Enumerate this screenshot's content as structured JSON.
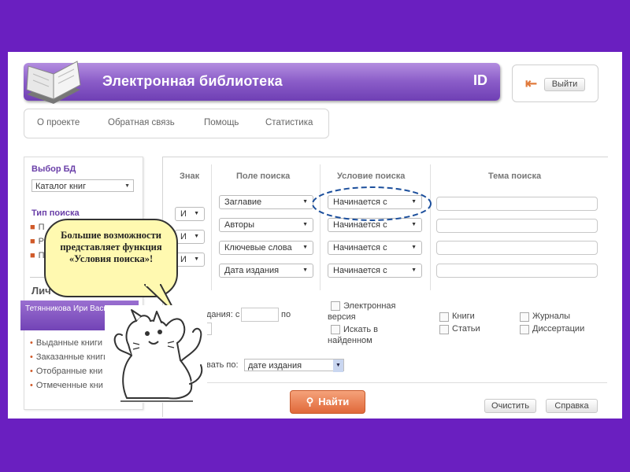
{
  "header": {
    "title": "Электронная библиотека",
    "logo_text": "ID",
    "exit_label": "Выйти"
  },
  "nav": {
    "items": [
      "О проекте",
      "Обратная связь",
      "Помощь",
      "Статистика"
    ]
  },
  "left_panel": {
    "db_title": "Выбор БД",
    "db_value": "Каталог книг",
    "search_type_title": "Тип поиска",
    "search_type_items": [
      "П",
      "Р",
      "П"
    ],
    "cabinet_title": "Лич",
    "user_name": "Тетянникова Ири Васильевна",
    "menu": [
      "Выданные книги",
      "Заказанные книги",
      "Отобранные кни",
      "Отмеченные кни"
    ]
  },
  "search": {
    "headers": {
      "sign": "Знак",
      "field": "Поле поиска",
      "condition": "Условие поиска",
      "topic": "Тема поиска"
    },
    "signs": [
      "И",
      "И",
      "И"
    ],
    "fields": [
      "Заглавие",
      "Авторы",
      "Ключевые слова",
      "Дата издания"
    ],
    "conditions": [
      "Начинается с",
      "Начинается с",
      "Начинается с",
      "Начинается с"
    ],
    "year_label": "дания: с",
    "year_to": "по",
    "electronic_label": "Электронная версия",
    "search_found_label": "Искать в найденном",
    "types": [
      "Книги",
      "Журналы",
      "Статьи",
      "Диссертации"
    ],
    "sort_label": "вать по:",
    "sort_value": "дате издания"
  },
  "buttons": {
    "find": "Найти",
    "clear": "Очистить",
    "help": "Справка"
  },
  "callout": {
    "text": "Большие возможности представляет функция «Условия поиска»!"
  },
  "colors": {
    "background": "#6a1fc0",
    "banner": "#8a5cc8",
    "accent_orange": "#e0693a",
    "highlight_ellipse": "#1c4f9c"
  }
}
